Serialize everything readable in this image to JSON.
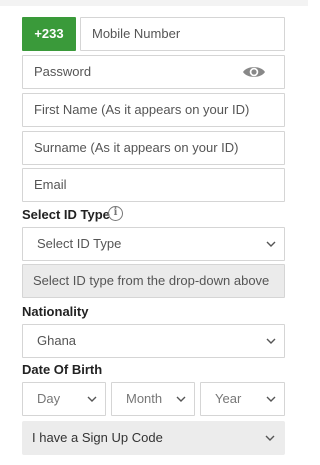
{
  "phone": {
    "country_code": "+233",
    "mobile_placeholder": "Mobile Number"
  },
  "password": {
    "placeholder": "Password",
    "toggle_icon": "eye-icon"
  },
  "first_name": {
    "placeholder": "First Name (As it appears on your ID)"
  },
  "surname": {
    "placeholder": "Surname (As it appears on your ID)"
  },
  "email": {
    "placeholder": "Email"
  },
  "id_type": {
    "label": "Select ID Type",
    "info_icon": "info-icon",
    "info_glyph": "i",
    "selected": "Select ID Type",
    "hint": "Select ID type from the drop-down above"
  },
  "nationality": {
    "label": "Nationality",
    "selected": "Ghana"
  },
  "dob": {
    "label": "Date Of Birth",
    "day": "Day",
    "month": "Month",
    "year": "Year"
  },
  "signup_code": {
    "label": "I have a Sign Up Code"
  },
  "colors": {
    "accent": "#3a9a3a",
    "border": "#d5d5d5",
    "hint_bg": "#ebebeb"
  }
}
